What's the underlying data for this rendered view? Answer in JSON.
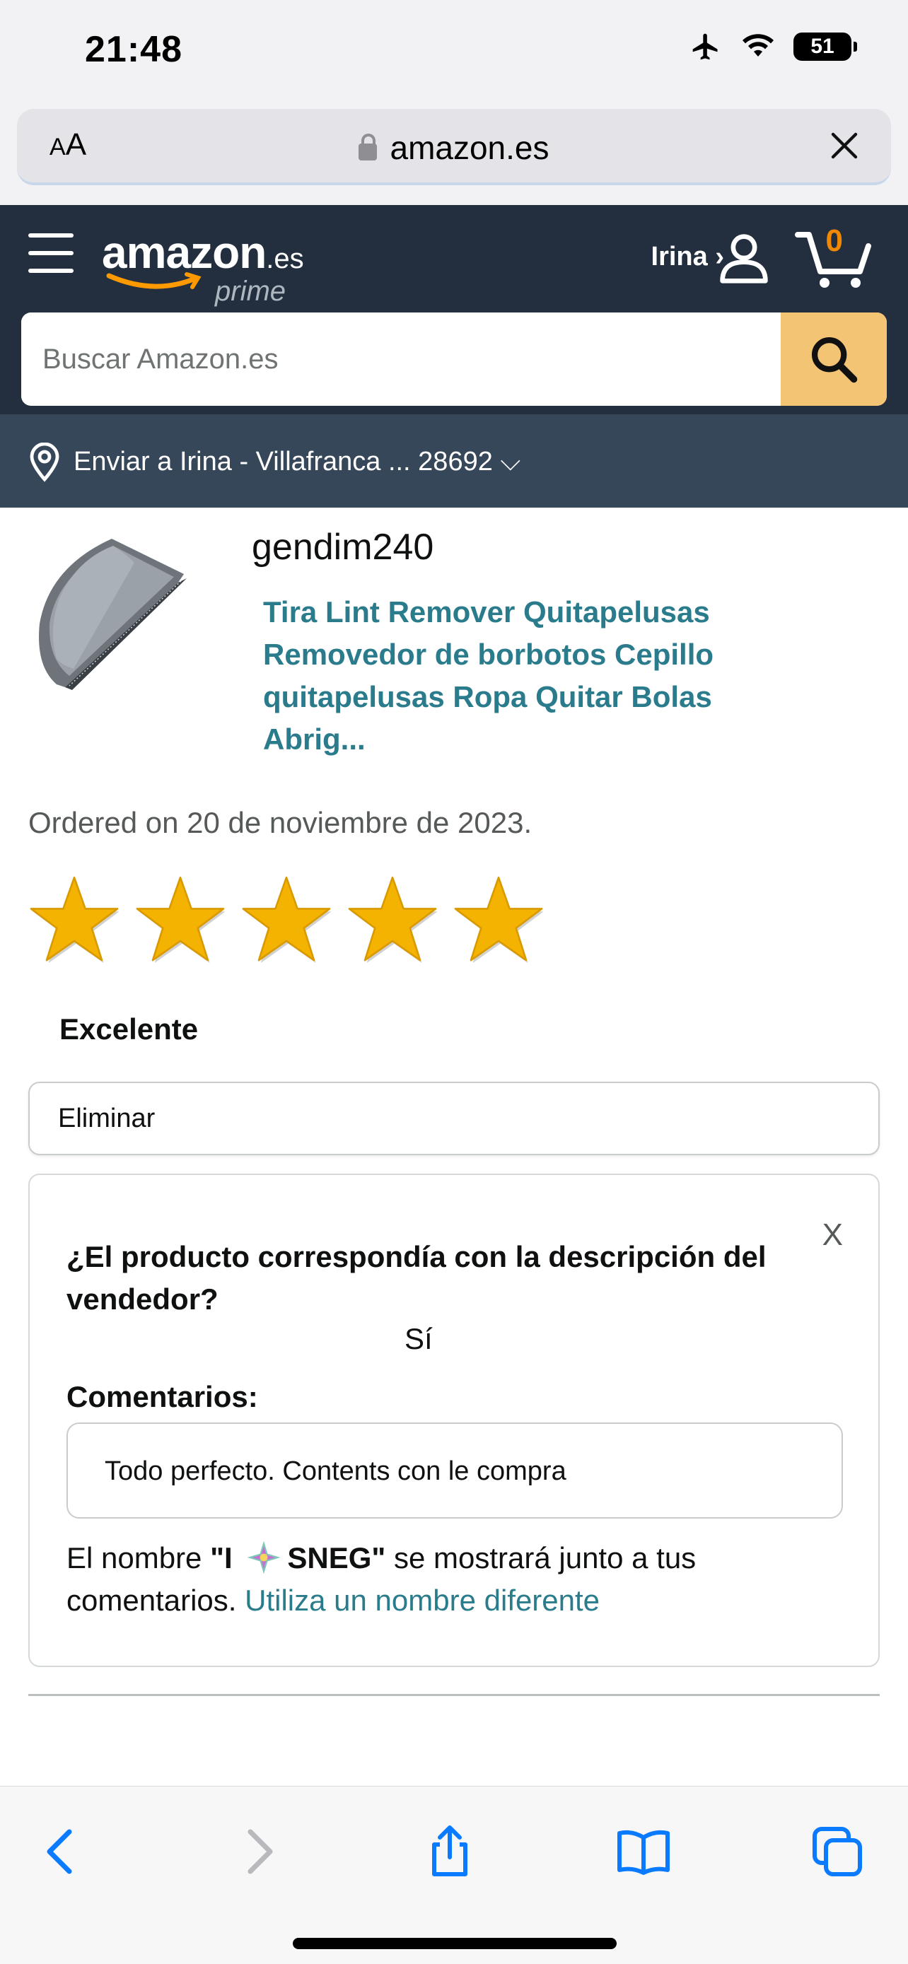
{
  "status_bar": {
    "time": "21:48",
    "battery": "51",
    "icons": [
      "airplane-icon",
      "wifi-icon",
      "battery-icon"
    ]
  },
  "browser": {
    "text_size_label_small": "A",
    "text_size_label_large": "A",
    "url": "amazon.es"
  },
  "header": {
    "logo_text": "amazon",
    "logo_suffix": ".es",
    "logo_prime": "prime",
    "user_label": "Irina ›",
    "cart_count": "0",
    "search_placeholder": "Buscar Amazon.es",
    "deliver_to": "Enviar a Irina - Villafranca ... 28692 ⌵"
  },
  "product": {
    "seller": "gendim240",
    "title": "Tira Lint Remover Quitapelusas Removedor de borbotos Cepillo quitapelusas Ropa Quitar Bolas Abrig...",
    "ordered": "Ordered on 20 de noviembre de 2023."
  },
  "rating": {
    "stars": 5,
    "max_stars": 5,
    "label": "Excelente"
  },
  "delete_label": "Eliminar",
  "feedback": {
    "close_label": "X",
    "question": "¿El producto correspondía con la descripción del vendedor?",
    "answer": "Sí",
    "comments_label": "Comentarios:",
    "comment": "Todo perfecto. Contents con le compra",
    "name_prefix": "El nombre ",
    "name_quote_open": "\"I",
    "name_quote_close": "SNEG\"",
    "name_suffix": " se mostrará junto a tus comentarios. ",
    "name_link": "Utiliza un nombre diferente"
  },
  "colors": {
    "header_bg": "#232f3e",
    "deliver_bg": "#37475a",
    "search_button": "#f3c474",
    "link": "#2a7c8c",
    "cart_count": "#f08804",
    "star": "#f5b301"
  }
}
